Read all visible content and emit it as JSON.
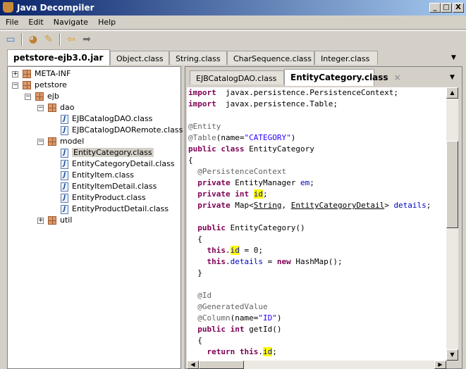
{
  "window": {
    "title": "Java Decompiler",
    "minimize": "_",
    "maximize": "□",
    "close": "X"
  },
  "menu": [
    "File",
    "Edit",
    "Navigate",
    "Help"
  ],
  "toolbar": {
    "icons": [
      "open-folder-icon",
      "open-type-icon",
      "search-icon",
      "back-arrow-icon",
      "forward-arrow-icon"
    ]
  },
  "outer_tabs": [
    {
      "label": "petstore-ejb3.0.jar",
      "active": true
    },
    {
      "label": "Object.class"
    },
    {
      "label": "String.class"
    },
    {
      "label": "CharSequence.class"
    },
    {
      "label": "Integer.class"
    }
  ],
  "inner_tabs": [
    {
      "label": "EJBCatalogDAO.class"
    },
    {
      "label": "EntityCategory.class",
      "active": true
    }
  ],
  "close_glyph": "×",
  "tree": [
    {
      "label": "META-INF",
      "type": "package",
      "level": 0,
      "toggle": "+"
    },
    {
      "label": "petstore",
      "type": "package",
      "level": 0,
      "toggle": "−"
    },
    {
      "label": "ejb",
      "type": "package",
      "level": 1,
      "toggle": "−"
    },
    {
      "label": "dao",
      "type": "package",
      "level": 2,
      "toggle": "−"
    },
    {
      "label": "EJBCatalogDAO.class",
      "type": "class",
      "level": 3
    },
    {
      "label": "EJBCatalogDAORemote.class",
      "type": "class",
      "level": 3
    },
    {
      "label": "model",
      "type": "package",
      "level": 2,
      "toggle": "−"
    },
    {
      "label": "EntityCategory.class",
      "type": "class",
      "level": 3,
      "selected": true
    },
    {
      "label": "EntityCategoryDetail.class",
      "type": "class",
      "level": 3
    },
    {
      "label": "EntityItem.class",
      "type": "class",
      "level": 3
    },
    {
      "label": "EntityItemDetail.class",
      "type": "class",
      "level": 3
    },
    {
      "label": "EntityProduct.class",
      "type": "class",
      "level": 3
    },
    {
      "label": "EntityProductDetail.class",
      "type": "class",
      "level": 3
    },
    {
      "label": "util",
      "type": "package",
      "level": 2,
      "toggle": "+"
    }
  ],
  "code": [
    [
      [
        "kw",
        "import"
      ],
      [
        "",
        "  javax.persistence.PersistenceContext;"
      ]
    ],
    [
      [
        "kw",
        "import"
      ],
      [
        "",
        "  javax.persistence.Table;"
      ]
    ],
    [],
    [
      [
        "an",
        "@Entity"
      ]
    ],
    [
      [
        "an",
        "@Table"
      ],
      [
        "",
        "(name="
      ],
      [
        "st",
        "\"CATEGORY\""
      ],
      [
        "",
        ")"
      ]
    ],
    [
      [
        "kw",
        "public class"
      ],
      [
        "",
        " EntityCategory"
      ]
    ],
    [
      [
        "",
        "{"
      ]
    ],
    [
      [
        "an",
        "  @PersistenceContext"
      ]
    ],
    [
      [
        "",
        "  "
      ],
      [
        "kw",
        "private"
      ],
      [
        "",
        " EntityManager "
      ],
      [
        "fd",
        "em"
      ],
      [
        "",
        ";"
      ]
    ],
    [
      [
        "",
        "  "
      ],
      [
        "kw",
        "private int"
      ],
      [
        "",
        " "
      ],
      [
        "fd hl",
        "id"
      ],
      [
        "",
        ";"
      ]
    ],
    [
      [
        "",
        "  "
      ],
      [
        "kw",
        "private"
      ],
      [
        "",
        " Map<"
      ],
      [
        "ul",
        "String"
      ],
      [
        "",
        ", "
      ],
      [
        "ul",
        "EntityCategoryDetail"
      ],
      [
        "",
        "> "
      ],
      [
        "fd",
        "details"
      ],
      [
        "",
        ";"
      ]
    ],
    [],
    [
      [
        "",
        "  "
      ],
      [
        "kw",
        "public"
      ],
      [
        "",
        " EntityCategory()"
      ]
    ],
    [
      [
        "",
        "  {"
      ]
    ],
    [
      [
        "",
        "    "
      ],
      [
        "kw",
        "this"
      ],
      [
        "",
        "."
      ],
      [
        "fd hl",
        "id"
      ],
      [
        "",
        " = 0;"
      ]
    ],
    [
      [
        "",
        "    "
      ],
      [
        "kw",
        "this"
      ],
      [
        "",
        "."
      ],
      [
        "fd",
        "details"
      ],
      [
        "",
        " = "
      ],
      [
        "kw",
        "new"
      ],
      [
        "",
        " HashMap();"
      ]
    ],
    [
      [
        "",
        "  }"
      ]
    ],
    [],
    [
      [
        "an",
        "  @Id"
      ]
    ],
    [
      [
        "an",
        "  @GeneratedValue"
      ]
    ],
    [
      [
        "an",
        "  @Column"
      ],
      [
        "",
        "(name="
      ],
      [
        "st",
        "\"ID\""
      ],
      [
        "",
        ")"
      ]
    ],
    [
      [
        "",
        "  "
      ],
      [
        "kw",
        "public int"
      ],
      [
        "",
        " getId()"
      ]
    ],
    [
      [
        "",
        "  {"
      ]
    ],
    [
      [
        "",
        "    "
      ],
      [
        "kw",
        "return this"
      ],
      [
        "",
        "."
      ],
      [
        "fd hl",
        "id"
      ],
      [
        "",
        ";"
      ]
    ]
  ]
}
